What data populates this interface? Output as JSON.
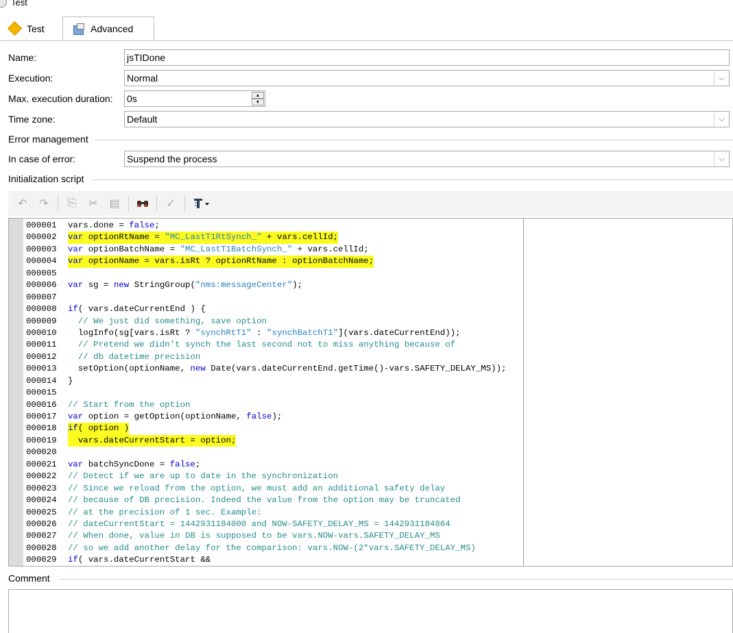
{
  "window": {
    "title": "Test",
    "icon": "app-icon"
  },
  "tabs": [
    {
      "label": "Test",
      "icon": "diamond-icon",
      "active": false
    },
    {
      "label": "Advanced",
      "icon": "properties-icon",
      "active": true
    }
  ],
  "form": {
    "name_label": "Name:",
    "name_value": "jsTIDone",
    "execution_label": "Execution:",
    "execution_value": "Normal",
    "max_duration_label": "Max. execution duration:",
    "max_duration_value": "0s",
    "timezone_label": "Time zone:",
    "timezone_value": "Default",
    "error_group_label": "Error management",
    "error_case_label": "In case of error:",
    "error_case_value": "Suspend the process",
    "init_script_label": "Initialization script",
    "comment_label": "Comment"
  },
  "toolbar": {
    "buttons": [
      "undo-icon",
      "redo-icon",
      "copy-icon",
      "cut-icon",
      "paste-icon",
      "find-icon",
      "check-icon",
      "insert-icon"
    ]
  },
  "code": [
    {
      "n": "000001",
      "t": "vars.done = false;"
    },
    {
      "n": "000002",
      "t": "var optionRtName = \"MC_LastT1RtSynch_\" + vars.cellId;"
    },
    {
      "n": "000003",
      "t": "var optionBatchName = \"MC_LastT1BatchSynch_\" + vars.cellId;"
    },
    {
      "n": "000004",
      "t": "var optionName = vars.isRt ? optionRtName : optionBatchName;"
    },
    {
      "n": "000005",
      "t": ""
    },
    {
      "n": "000006",
      "t": "var sg = new StringGroup(\"nms:messageCenter\");"
    },
    {
      "n": "000007",
      "t": ""
    },
    {
      "n": "000008",
      "t": "if( vars.dateCurrentEnd ) {"
    },
    {
      "n": "000009",
      "t": "  // We just did something, save option"
    },
    {
      "n": "000010",
      "t": "  logInfo(sg[vars.isRt ? \"synchRtT1\" : \"synchBatchT1\"](vars.dateCurrentEnd));"
    },
    {
      "n": "000011",
      "t": "  // Pretend we didn't synch the last second not to miss anything because of"
    },
    {
      "n": "000012",
      "t": "  // db datetime precision"
    },
    {
      "n": "000013",
      "t": "  setOption(optionName, new Date(vars.dateCurrentEnd.getTime()-vars.SAFETY_DELAY_MS));"
    },
    {
      "n": "000014",
      "t": "}"
    },
    {
      "n": "000015",
      "t": ""
    },
    {
      "n": "000016",
      "t": "// Start from the option"
    },
    {
      "n": "000017",
      "t": "var option = getOption(optionName, false);"
    },
    {
      "n": "000018",
      "t": "if( option )"
    },
    {
      "n": "000019",
      "t": "  vars.dateCurrentStart = option;"
    },
    {
      "n": "000020",
      "t": ""
    },
    {
      "n": "000021",
      "t": "var batchSyncDone = false;"
    },
    {
      "n": "000022",
      "t": "// Detect if we are up to date in the synchronization"
    },
    {
      "n": "000023",
      "t": "// Since we reload from the option, we must add an additional safety delay"
    },
    {
      "n": "000024",
      "t": "// because of DB precision. Indeed the value from the option may be truncated"
    },
    {
      "n": "000025",
      "t": "// at the precision of 1 sec. Example:"
    },
    {
      "n": "000026",
      "t": "// dateCurrentStart = 1442931184000 and NOW-SAFETY_DELAY_MS = 1442931184864"
    },
    {
      "n": "000027",
      "t": "// When done, value in DB is supposed to be vars.NOW-vars.SAFETY_DELAY_MS"
    },
    {
      "n": "000028",
      "t": "// so we add another delay for the comparison: vars.NOW-(2*vars.SAFETY_DELAY_MS)"
    },
    {
      "n": "000029",
      "t": "if( vars.dateCurrentStart &&"
    }
  ],
  "highlighted_lines": [
    "000002",
    "000004",
    "000018",
    "000019"
  ],
  "colors": {
    "highlight": "#fbfb22",
    "keyword": "#0000cc",
    "string": "#2a7fb8",
    "comment": "#2a8a8a"
  }
}
